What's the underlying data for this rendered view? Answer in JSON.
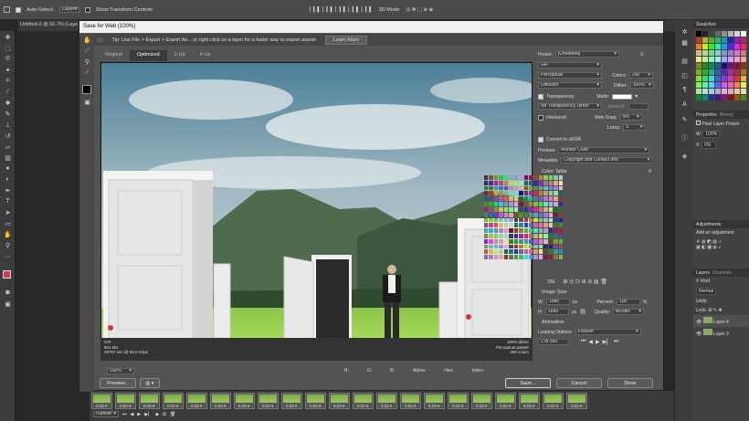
{
  "options_bar": {
    "auto_select": "Auto-Select:",
    "layer_select": "Layer",
    "transform_controls": "Show Transform Controls",
    "mode_3d": "3D Mode:"
  },
  "doc_tab": {
    "title": "Untitled-2 @ 66.7% (Laye"
  },
  "dialog": {
    "title": "Save for Web (100%)",
    "tip": "Tip: Use File > Export > Export As... or right click on a layer for a faster way to export assets",
    "learn_more": "Learn More",
    "tabs": [
      "Original",
      "Optimized",
      "2-Up",
      "4-Up"
    ],
    "info_left": [
      "GIF",
      "601.5M",
      "29757 sec @ 56.6 Kbps"
    ],
    "info_right": [
      "100% dither",
      "Perceptual palette",
      "256 colors"
    ],
    "zoom": "100%",
    "status": {
      "r": "R:",
      "g": "G:",
      "b": "B:",
      "alpha": "Alpha:",
      "hex": "Hex:",
      "index": "Index:"
    },
    "buttons": {
      "preview": "Preview...",
      "save": "Save...",
      "cancel": "Cancel",
      "done": "Done"
    }
  },
  "settings": {
    "preset_label": "Preset:",
    "preset_value": "[Unnamed]",
    "format": "GIF",
    "reduction": "Perceptual",
    "colors_label": "Colors:",
    "colors_value": "256",
    "dither_algo": "Diffusion",
    "dither_label": "Dither:",
    "dither_value": "100%",
    "transparency": "Transparency",
    "matte_label": "Matte:",
    "trans_dither": "No Transparency Dither",
    "amount_label": "Amount:",
    "interlaced": "Interlaced",
    "websnap_label": "Web Snap:",
    "websnap_value": "0%",
    "lossy_label": "Lossy:",
    "lossy_value": "0",
    "convert_srgb": "Convert to sRGB",
    "preview_label": "Preview:",
    "preview_value": "Monitor Color",
    "metadata_label": "Metadata:",
    "metadata_value": "Copyright and Contact Info",
    "color_table": "Color Table",
    "color_count": "256",
    "image_size": "Image Size",
    "w_label": "W:",
    "w_value": "1080",
    "h_label": "H:",
    "h_value": "1080",
    "px": "px",
    "percent_label": "Percent:",
    "percent_value": "100",
    "percent_sign": "%",
    "quality_label": "Quality:",
    "quality_value": "Bicubic",
    "animation": "Animation",
    "looping_label": "Looping Options:",
    "looping_value": "Forever",
    "frame_counter": "1 of 390"
  },
  "timeline": {
    "frame_delay": "0.03",
    "loop": "Forever"
  },
  "panels": {
    "swatches": "Swatches",
    "properties": "Properties",
    "history": "History",
    "pixel_layer": "Pixel Layer Proper",
    "w_label": "W:",
    "w_value": "100%",
    "x_label": "X:",
    "x_value": "0%",
    "adjustments": "Adjustments",
    "add_adjustment": "Add an adjustment",
    "layers": "Layers",
    "channels": "Channels",
    "kind": "Kind",
    "blend": "Normal",
    "unify": "Unify:",
    "lock": "Lock:",
    "layer4": "Layer 4",
    "layer3": "Layer 3"
  },
  "colors": {
    "chrome": "#535353",
    "accent": "#d9374a",
    "dark": "#282828"
  }
}
